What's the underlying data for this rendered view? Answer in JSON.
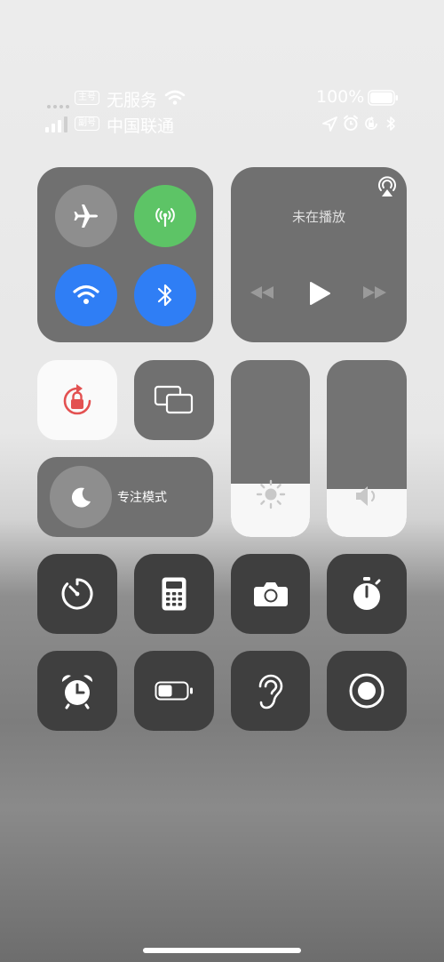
{
  "status_bar": {
    "sim1_badge": "主号",
    "sim1_carrier": "无服务",
    "sim2_badge": "副号",
    "sim2_carrier": "中国联通",
    "battery_percent": "100%"
  },
  "connectivity": {
    "airplane_mode": {
      "icon": "airplane-icon",
      "on": false
    },
    "cellular_data": {
      "icon": "antenna-icon",
      "on": true,
      "color": "#5dc466"
    },
    "wifi": {
      "icon": "wifi-icon",
      "on": true,
      "color": "#2f7ef5"
    },
    "bluetooth": {
      "icon": "bluetooth-icon",
      "on": true,
      "color": "#2f7ef5"
    }
  },
  "now_playing": {
    "title": "未在播放",
    "airplay_icon": "airplay-icon",
    "controls": [
      "rewind-icon",
      "play-icon",
      "fast-forward-icon"
    ]
  },
  "orientation_lock": {
    "icon": "rotation-lock-icon",
    "on": true,
    "color": "#e35151"
  },
  "screen_mirroring": {
    "icon": "screen-mirroring-icon"
  },
  "focus": {
    "label": "专注模式",
    "icon": "moon-icon"
  },
  "brightness": {
    "level": 0.3,
    "icon": "sun-icon"
  },
  "volume": {
    "level": 0.27,
    "icon": "speaker-icon"
  },
  "shortcuts": [
    {
      "name": "timer",
      "icon": "timer-icon"
    },
    {
      "name": "calculator",
      "icon": "calculator-icon"
    },
    {
      "name": "camera",
      "icon": "camera-icon"
    },
    {
      "name": "stopwatch",
      "icon": "stopwatch-icon"
    },
    {
      "name": "alarm",
      "icon": "alarm-clock-icon"
    },
    {
      "name": "low-power-mode",
      "icon": "battery-icon"
    },
    {
      "name": "hearing",
      "icon": "ear-icon"
    },
    {
      "name": "screen-recording",
      "icon": "record-icon"
    }
  ]
}
